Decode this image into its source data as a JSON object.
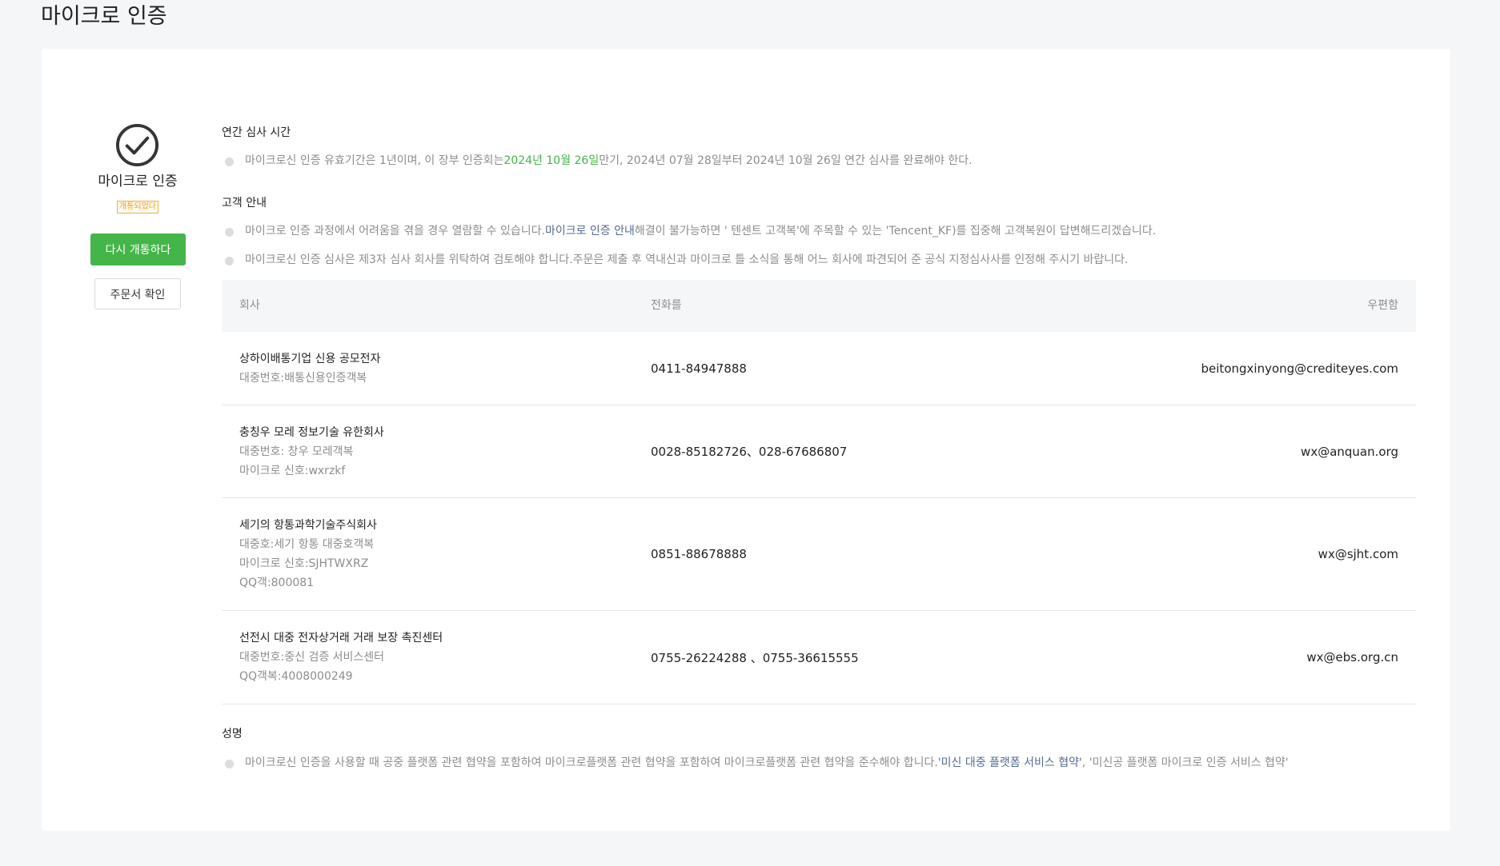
{
  "page": {
    "title": "마이크로 인증"
  },
  "left": {
    "auth_title": "마이크로 인증",
    "status_badge": "개통되었다",
    "reopen_button": "다시 개통하다",
    "order_button": "주문서 확인"
  },
  "annual": {
    "title": "연간 심사 시간",
    "text_before": "마이크로신 인증 유효기간은 1년이며, 이 장부 인증회는",
    "date_highlight": "2024년 10월 26일",
    "text_after": "만기, 2024년 07월 28일부터 2024년 10월 26일 연간 심사를 완료해야 한다."
  },
  "guide": {
    "title": "고객 안내",
    "item1_before": "마이크로 인증 과정에서 어려움을 겪을 경우 열람할 수 있습니다.",
    "item1_link": "마이크로 인증 안내",
    "item1_after": "해결이 불가능하면 ' 텐센트 고객복'에 주목할 수 있는 'Tencent_KF)를 집중해 고객복원이 답변해드리겠습니다.",
    "item2": "마이크로신 인증 심사은 제3자 심사 회사를 위탁하여 검토해야 합니다.주문은 제출 후 역내신과 마이크로 틀 소식을 통해 어느 회사에 파견되어 준 공식 지정심사사를 인정해 주시기 바랍니다."
  },
  "table": {
    "headers": {
      "company": "회사",
      "phone": "전화를",
      "email": "우편함"
    },
    "rows": [
      {
        "name": "상하이배통기업 신용 공모전자",
        "details": [
          "대중번호:배통신용인증객복"
        ],
        "phone": "0411-84947888",
        "email": "beitongxinyong@crediteyes.com"
      },
      {
        "name": "충칭우 모레 정보기술 유한회사",
        "details": [
          "대중번호: 창우 모레객복",
          "마이크로 신호:wxrzkf"
        ],
        "phone": "0028-85182726、028-67686807",
        "email": "wx@anquan.org"
      },
      {
        "name": "세기의 항통과학기술주식회사",
        "details": [
          "대중호:세기 항통 대중호객복",
          "마이크로 신호:SJHTWXRZ",
          "QQ객:800081"
        ],
        "phone": "0851-88678888",
        "email": "wx@sjht.com"
      },
      {
        "name": "선전시 대중 전자상거래 거래 보장 촉진센터",
        "details": [
          "대중번호:중신 검증 서비스센터",
          "QQ객복:4008000249"
        ],
        "phone": "0755-26224288 、0755-36615555",
        "email": "wx@ebs.org.cn"
      }
    ]
  },
  "statement": {
    "title": "성명",
    "text_before": "마이크로신 인증을 사용할 때 공중 플랫폼 관련 협약을 포함하여 마이크로플랫폼 관련 협약을 포함하여 마이크로플랫폼 관련 협약을 준수해야 합니다.",
    "link1": "'미신 대중 플랫폼 서비스 협약'",
    "text_after": ", '미신공 플랫폼 마이크로 인증 서비스 협약'"
  }
}
